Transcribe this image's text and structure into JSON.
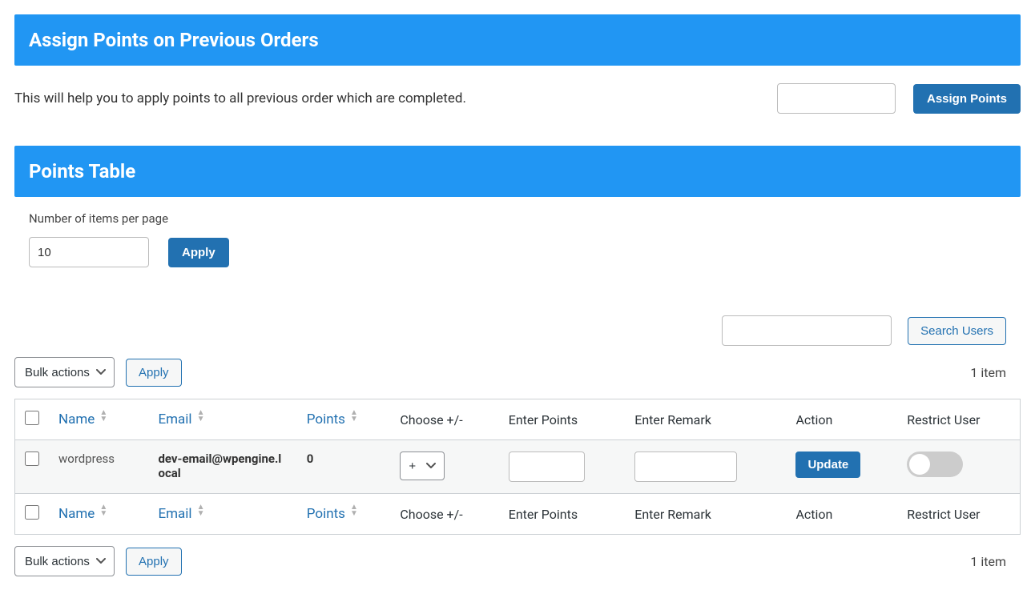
{
  "section_assign": {
    "title": "Assign Points on Previous Orders",
    "description": "This will help you to apply points to all previous order which are completed.",
    "input_value": "",
    "button": "Assign Points"
  },
  "section_table": {
    "title": "Points Table",
    "items_per_page_label": "Number of items per page",
    "items_per_page_value": "10",
    "apply_button": "Apply",
    "search_value": "",
    "search_button": "Search Users",
    "bulk_action_selected": "Bulk actions",
    "bulk_apply": "Apply",
    "item_count": "1 item",
    "columns": {
      "name": "Name",
      "email": "Email",
      "points": "Points",
      "choose": "Choose +/-",
      "enter_points": "Enter Points",
      "enter_remark": "Enter Remark",
      "action": "Action",
      "restrict": "Restrict User"
    },
    "rows": [
      {
        "name": "wordpress",
        "email": "dev-email@wpengine.local",
        "points": "0",
        "choose": "+",
        "enter_points": "",
        "enter_remark": "",
        "action_label": "Update",
        "restricted": false
      }
    ]
  }
}
